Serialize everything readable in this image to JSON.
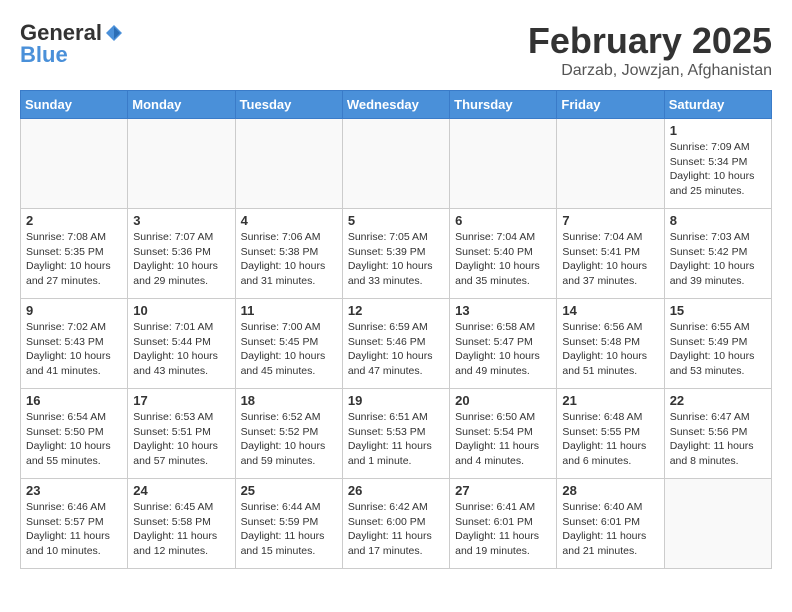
{
  "header": {
    "logo_general": "General",
    "logo_blue": "Blue",
    "month": "February 2025",
    "location": "Darzab, Jowzjan, Afghanistan"
  },
  "weekdays": [
    "Sunday",
    "Monday",
    "Tuesday",
    "Wednesday",
    "Thursday",
    "Friday",
    "Saturday"
  ],
  "weeks": [
    [
      {
        "day": "",
        "info": ""
      },
      {
        "day": "",
        "info": ""
      },
      {
        "day": "",
        "info": ""
      },
      {
        "day": "",
        "info": ""
      },
      {
        "day": "",
        "info": ""
      },
      {
        "day": "",
        "info": ""
      },
      {
        "day": "1",
        "info": "Sunrise: 7:09 AM\nSunset: 5:34 PM\nDaylight: 10 hours\nand 25 minutes."
      }
    ],
    [
      {
        "day": "2",
        "info": "Sunrise: 7:08 AM\nSunset: 5:35 PM\nDaylight: 10 hours\nand 27 minutes."
      },
      {
        "day": "3",
        "info": "Sunrise: 7:07 AM\nSunset: 5:36 PM\nDaylight: 10 hours\nand 29 minutes."
      },
      {
        "day": "4",
        "info": "Sunrise: 7:06 AM\nSunset: 5:38 PM\nDaylight: 10 hours\nand 31 minutes."
      },
      {
        "day": "5",
        "info": "Sunrise: 7:05 AM\nSunset: 5:39 PM\nDaylight: 10 hours\nand 33 minutes."
      },
      {
        "day": "6",
        "info": "Sunrise: 7:04 AM\nSunset: 5:40 PM\nDaylight: 10 hours\nand 35 minutes."
      },
      {
        "day": "7",
        "info": "Sunrise: 7:04 AM\nSunset: 5:41 PM\nDaylight: 10 hours\nand 37 minutes."
      },
      {
        "day": "8",
        "info": "Sunrise: 7:03 AM\nSunset: 5:42 PM\nDaylight: 10 hours\nand 39 minutes."
      }
    ],
    [
      {
        "day": "9",
        "info": "Sunrise: 7:02 AM\nSunset: 5:43 PM\nDaylight: 10 hours\nand 41 minutes."
      },
      {
        "day": "10",
        "info": "Sunrise: 7:01 AM\nSunset: 5:44 PM\nDaylight: 10 hours\nand 43 minutes."
      },
      {
        "day": "11",
        "info": "Sunrise: 7:00 AM\nSunset: 5:45 PM\nDaylight: 10 hours\nand 45 minutes."
      },
      {
        "day": "12",
        "info": "Sunrise: 6:59 AM\nSunset: 5:46 PM\nDaylight: 10 hours\nand 47 minutes."
      },
      {
        "day": "13",
        "info": "Sunrise: 6:58 AM\nSunset: 5:47 PM\nDaylight: 10 hours\nand 49 minutes."
      },
      {
        "day": "14",
        "info": "Sunrise: 6:56 AM\nSunset: 5:48 PM\nDaylight: 10 hours\nand 51 minutes."
      },
      {
        "day": "15",
        "info": "Sunrise: 6:55 AM\nSunset: 5:49 PM\nDaylight: 10 hours\nand 53 minutes."
      }
    ],
    [
      {
        "day": "16",
        "info": "Sunrise: 6:54 AM\nSunset: 5:50 PM\nDaylight: 10 hours\nand 55 minutes."
      },
      {
        "day": "17",
        "info": "Sunrise: 6:53 AM\nSunset: 5:51 PM\nDaylight: 10 hours\nand 57 minutes."
      },
      {
        "day": "18",
        "info": "Sunrise: 6:52 AM\nSunset: 5:52 PM\nDaylight: 10 hours\nand 59 minutes."
      },
      {
        "day": "19",
        "info": "Sunrise: 6:51 AM\nSunset: 5:53 PM\nDaylight: 11 hours\nand 1 minute."
      },
      {
        "day": "20",
        "info": "Sunrise: 6:50 AM\nSunset: 5:54 PM\nDaylight: 11 hours\nand 4 minutes."
      },
      {
        "day": "21",
        "info": "Sunrise: 6:48 AM\nSunset: 5:55 PM\nDaylight: 11 hours\nand 6 minutes."
      },
      {
        "day": "22",
        "info": "Sunrise: 6:47 AM\nSunset: 5:56 PM\nDaylight: 11 hours\nand 8 minutes."
      }
    ],
    [
      {
        "day": "23",
        "info": "Sunrise: 6:46 AM\nSunset: 5:57 PM\nDaylight: 11 hours\nand 10 minutes."
      },
      {
        "day": "24",
        "info": "Sunrise: 6:45 AM\nSunset: 5:58 PM\nDaylight: 11 hours\nand 12 minutes."
      },
      {
        "day": "25",
        "info": "Sunrise: 6:44 AM\nSunset: 5:59 PM\nDaylight: 11 hours\nand 15 minutes."
      },
      {
        "day": "26",
        "info": "Sunrise: 6:42 AM\nSunset: 6:00 PM\nDaylight: 11 hours\nand 17 minutes."
      },
      {
        "day": "27",
        "info": "Sunrise: 6:41 AM\nSunset: 6:01 PM\nDaylight: 11 hours\nand 19 minutes."
      },
      {
        "day": "28",
        "info": "Sunrise: 6:40 AM\nSunset: 6:01 PM\nDaylight: 11 hours\nand 21 minutes."
      },
      {
        "day": "",
        "info": ""
      }
    ]
  ]
}
